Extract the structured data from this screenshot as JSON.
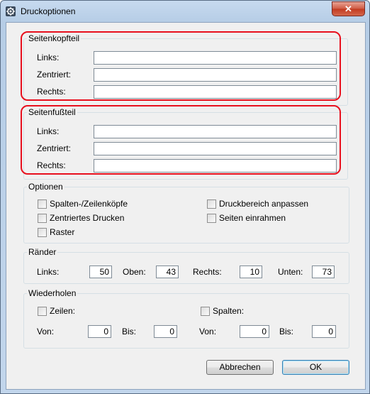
{
  "window": {
    "title": "Druckoptionen",
    "close_glyph": "✕"
  },
  "header_group": {
    "legend": "Seitenkopfteil",
    "fields": [
      {
        "label": "Links:",
        "value": ""
      },
      {
        "label": "Zentriert:",
        "value": ""
      },
      {
        "label": "Rechts:",
        "value": ""
      }
    ]
  },
  "footer_group": {
    "legend": "Seitenfußteil",
    "fields": [
      {
        "label": "Links:",
        "value": ""
      },
      {
        "label": "Zentriert:",
        "value": ""
      },
      {
        "label": "Rechts:",
        "value": ""
      }
    ]
  },
  "options_group": {
    "legend": "Optionen",
    "items": [
      {
        "label": "Spalten-/Zeilenköpfe",
        "checked": false
      },
      {
        "label": "Zentriertes Drucken",
        "checked": false
      },
      {
        "label": "Raster",
        "checked": false
      },
      {
        "label": "Druckbereich anpassen",
        "checked": false
      },
      {
        "label": "Seiten einrahmen",
        "checked": false
      }
    ]
  },
  "margins_group": {
    "legend": "Ränder",
    "fields": [
      {
        "label": "Links:",
        "value": "50"
      },
      {
        "label": "Oben:",
        "value": "43"
      },
      {
        "label": "Rechts:",
        "value": "10"
      },
      {
        "label": "Unten:",
        "value": "73"
      }
    ]
  },
  "repeat_group": {
    "legend": "Wiederholen",
    "rows": {
      "label": "Zeilen:",
      "checked": false,
      "from_label": "Von:",
      "from_value": "0",
      "to_label": "Bis:",
      "to_value": "0"
    },
    "columns": {
      "label": "Spalten:",
      "checked": false,
      "from_label": "Von:",
      "from_value": "0",
      "to_label": "Bis:",
      "to_value": "0"
    }
  },
  "buttons": {
    "cancel": "Abbrechen",
    "ok": "OK"
  },
  "colors": {
    "highlight": "#e8101e",
    "title_bar": "#b9d1ea",
    "dialog_bg": "#f0f0f0",
    "close_button": "#c94a33"
  }
}
